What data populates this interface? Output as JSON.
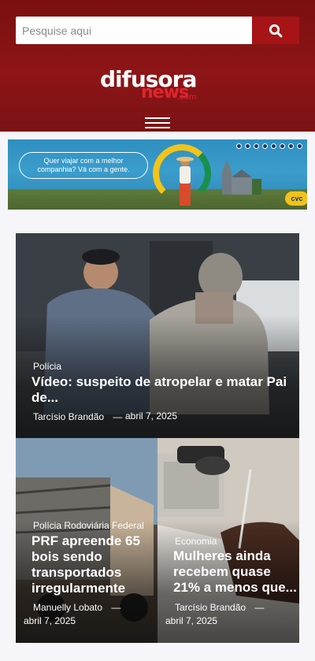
{
  "search": {
    "placeholder": "Pesquise aqui"
  },
  "logo": {
    "line1": "difusora",
    "line2": "news",
    "suffix": ".com"
  },
  "banner": {
    "text": "Quer viajar com a melhor companhia? Vá com a gente.",
    "brand": "cvc"
  },
  "articles": [
    {
      "category": "Polícia",
      "title": "Vídeo: suspeito de atropelar e matar Pai de...",
      "author": "Tarcísio Brandão",
      "separator": "—",
      "date": "abril 7, 2025"
    },
    {
      "category": "Polícia Rodoviária Federal",
      "title": "PRF apreende 65 bois sendo transportados irregularmente",
      "author": "Manuelly Lobato",
      "separator": "—",
      "date": "abril 7, 2025"
    },
    {
      "category": "Economia",
      "title": "Mulheres ainda recebem quase 21% a menos que...",
      "author": "Tarcísio Brandão",
      "separator": "—",
      "date": "abril 7, 2025"
    }
  ],
  "colors": {
    "header": "#7a0f10",
    "search_button": "#a61416",
    "logo_accent": "#e0242c"
  }
}
